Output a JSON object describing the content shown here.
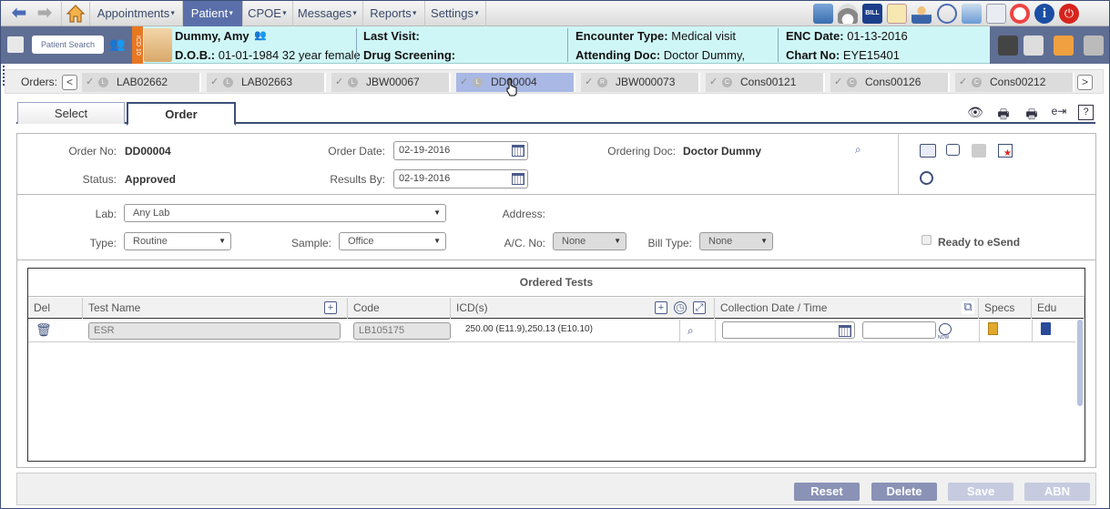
{
  "top_menu": {
    "items": [
      "Appointments",
      "Patient",
      "CPOE",
      "Messages",
      "Reports",
      "Settings"
    ],
    "active": "Patient"
  },
  "toolbar_icons": [
    "dashboard-icon",
    "gauge-icon",
    "bill-icon",
    "calendar-icon",
    "doctor-icon",
    "stethoscope-icon",
    "download-icon",
    "document-icon",
    "help-ring-icon",
    "info-icon",
    "power-icon"
  ],
  "patient": {
    "search_label": "Patient Search",
    "tag": "ICD 10",
    "name": "Dummy, Amy",
    "dob_label": "D.O.B.:",
    "dob_value": "01-01-1984 32 year female",
    "last_visit_label": "Last Visit:",
    "drug_screening_label": "Drug Screening:",
    "encounter_type_label": "Encounter Type:",
    "encounter_type_value": "Medical visit",
    "attending_doc_label": "Attending Doc:",
    "attending_doc_value": "Doctor Dummy,",
    "enc_date_label": "ENC Date:",
    "enc_date_value": "01-13-2016",
    "chart_no_label": "Chart No:",
    "chart_no_value": "EYE15401"
  },
  "orders": {
    "label": "Orders:",
    "tabs": [
      {
        "id": "LAB02662",
        "status": "L"
      },
      {
        "id": "LAB02663",
        "status": "L"
      },
      {
        "id": "JBW00067",
        "status": "L"
      },
      {
        "id": "DD00004",
        "status": "L"
      },
      {
        "id": "JBW000073",
        "status": "R"
      },
      {
        "id": "Cons00121",
        "status": "C"
      },
      {
        "id": "Cons00126",
        "status": "C"
      },
      {
        "id": "Cons00212",
        "status": "C"
      }
    ],
    "active": "DD00004"
  },
  "sub_tabs": [
    "Select",
    "Order"
  ],
  "form": {
    "order_no_label": "Order No:",
    "order_no": "DD00004",
    "status_label": "Status:",
    "status": "Approved",
    "order_date_label": "Order Date:",
    "order_date": "02-19-2016",
    "results_by_label": "Results By:",
    "results_by": "02-19-2016",
    "ordering_doc_label": "Ordering Doc:",
    "ordering_doc": "Doctor Dummy",
    "lab_label": "Lab:",
    "lab": "Any Lab",
    "address_label": "Address:",
    "type_label": "Type:",
    "type": "Routine",
    "sample_label": "Sample:",
    "sample": "Office",
    "ac_no_label": "A/C. No:",
    "ac_no": "None",
    "bill_type_label": "Bill Type:",
    "bill_type": "None",
    "ready_label": "Ready to eSend"
  },
  "tests": {
    "title": "Ordered Tests",
    "columns": [
      "Del",
      "Test Name",
      "Code",
      "ICD(s)",
      "Collection Date / Time",
      "Specs",
      "Edu"
    ],
    "rows": [
      {
        "test_name": "ESR",
        "code": "LB105175",
        "icds": "250.00 (E11.9),250.13 (E10.10)"
      }
    ],
    "now_label": "NOW"
  },
  "footer": {
    "buttons": [
      "Reset",
      "Delete",
      "Save",
      "ABN"
    ]
  },
  "colors": {
    "accent": "#5a6fa9",
    "patient_strip": "#cff6f6",
    "active_order_tab": "#a9b8e4",
    "button": "#8a92b6"
  }
}
